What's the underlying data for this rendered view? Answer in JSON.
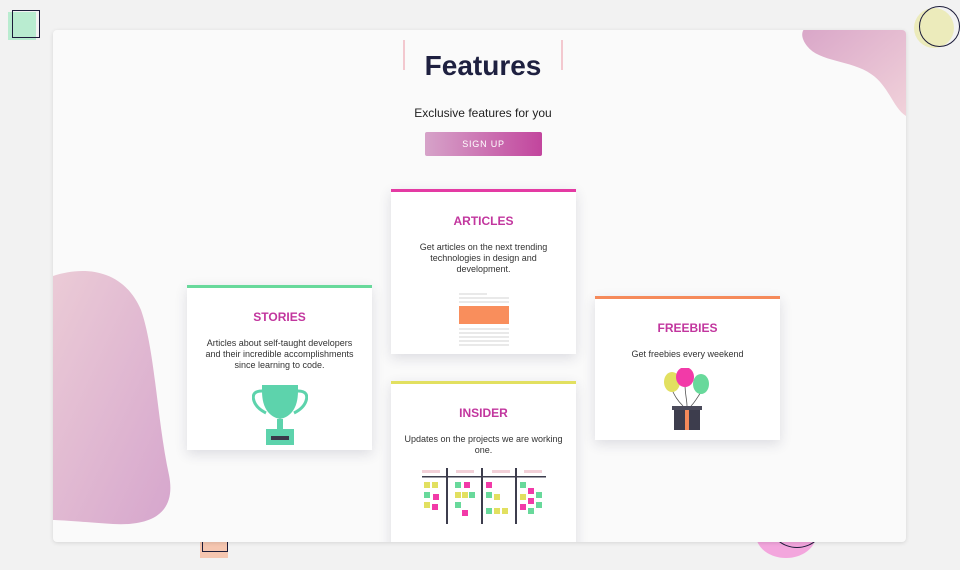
{
  "header": {
    "title": "Features",
    "subtitle": "Exclusive features for you",
    "signup_label": "SIGN UP"
  },
  "cards": {
    "articles": {
      "title": "ARTICLES",
      "description": "Get articles on the next trending technologies in design and development.",
      "accent": "#e43aa3",
      "icon": "document-icon"
    },
    "stories": {
      "title": "STORIES",
      "description": "Articles about self-taught developers and their incredible accomplishments since learning to code.",
      "accent": "#68d99b",
      "icon": "trophy-icon"
    },
    "freebies": {
      "title": "FREEBIES",
      "description": "Get freebies every weekend",
      "accent": "#f58a5a",
      "icon": "balloons-gift-icon"
    },
    "insider": {
      "title": "INSIDER",
      "description": "Updates on the projects we are working one.",
      "accent": "#e2e060",
      "icon": "kanban-board-icon"
    }
  },
  "colors": {
    "title": "#1e2040",
    "card_title": "#c2369e",
    "button_gradient_start": "#d6a3c9",
    "button_gradient_end": "#c2459d"
  }
}
